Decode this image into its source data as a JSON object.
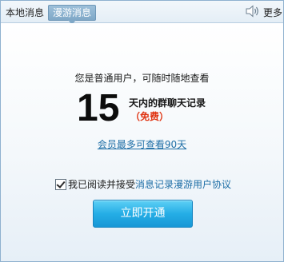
{
  "tabs": {
    "local": "本地消息",
    "roaming": "漫游消息"
  },
  "toolbar": {
    "speaker_icon": "speaker-icon",
    "more_label": "更多"
  },
  "promo": {
    "intro": "您是普通用户，可随时随地查看",
    "days": "15",
    "days_text": "天内的群聊天记录",
    "free_text": "（免费）",
    "vip_link": "会员最多可查看90天"
  },
  "agreement": {
    "checked": true,
    "prefix": "我已阅读并接受",
    "link": "消息记录漫游用户协议"
  },
  "action": {
    "open_label": "立即开通"
  },
  "colors": {
    "accent": "#25aee6",
    "link": "#1e6ea6",
    "free": "#e03412"
  }
}
